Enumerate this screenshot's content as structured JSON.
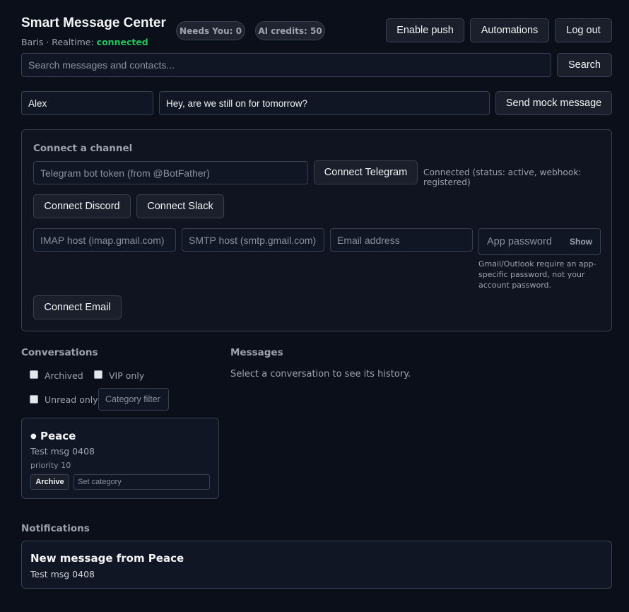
{
  "header": {
    "title": "Smart Message Center",
    "user": "Baris",
    "realtime_label": " · Realtime: ",
    "realtime_status": "connected",
    "needs_you": "Needs You: 0",
    "ai_credits": "AI credits: 50",
    "enable_push": "Enable push",
    "automations": "Automations",
    "logout": "Log out"
  },
  "search": {
    "placeholder": "Search messages and contacts...",
    "button": "Search"
  },
  "mock": {
    "name": "Alex",
    "message": "Hey, are we still on for tomorrow?",
    "button": "Send mock message"
  },
  "channel": {
    "heading": "Connect a channel",
    "telegram_placeholder": "Telegram bot token (from @BotFather)",
    "telegram_button": "Connect Telegram",
    "telegram_status": "Connected (status: active, webhook: registered)",
    "discord_button": "Connect Discord",
    "slack_button": "Connect Slack",
    "imap_placeholder": "IMAP host (imap.gmail.com)",
    "smtp_placeholder": "SMTP host (smtp.gmail.com)",
    "email_placeholder": "Email address",
    "password_placeholder": "App password",
    "show_button": "Show",
    "password_hint": "Gmail/Outlook require an app-specific password, not your account password.",
    "email_button": "Connect Email"
  },
  "conversations": {
    "heading": "Conversations",
    "filter_archived": "Archived",
    "filter_vip": "VIP only",
    "filter_unread": "Unread only",
    "category_filter": "Category filter",
    "items": [
      {
        "bullet": "●",
        "name": "Peace",
        "preview": "Test msg 0408",
        "priority": "priority 10",
        "archive": "Archive",
        "category_placeholder": "Set category"
      }
    ]
  },
  "messages": {
    "heading": "Messages",
    "empty": "Select a conversation to see its history."
  },
  "notifications": {
    "heading": "Notifications",
    "items": [
      {
        "title": "New message from Peace",
        "body": "Test msg 0408"
      }
    ]
  }
}
